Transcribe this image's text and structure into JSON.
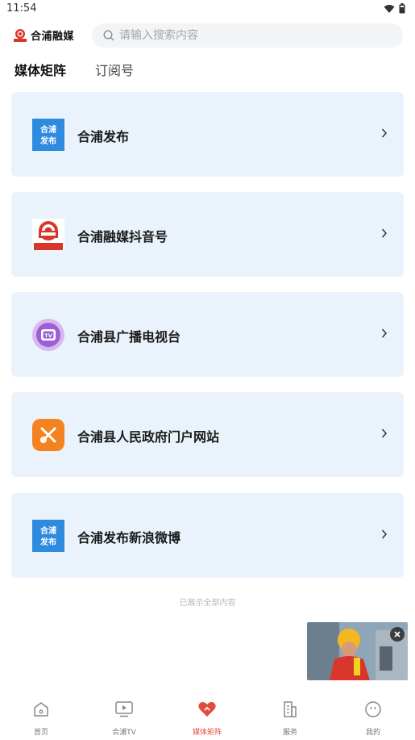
{
  "status_bar": {
    "time": "11:54"
  },
  "header": {
    "logo_text": "合浦融媒",
    "search_placeholder": "请输入搜索内容"
  },
  "tabs": [
    {
      "label": "媒体矩阵",
      "active": true
    },
    {
      "label": "订阅号",
      "active": false
    }
  ],
  "cards": [
    {
      "title": "合浦发布",
      "icon": "hepu-fabu-logo"
    },
    {
      "title": "合浦融媒抖音号",
      "icon": "hepu-rongmei-logo"
    },
    {
      "title": "合浦县广播电视台",
      "icon": "tv-icon"
    },
    {
      "title": "合浦县人民政府门户网站",
      "icon": "government-portal-icon"
    },
    {
      "title": "合浦发布新浪微博",
      "icon": "hepu-fabu-logo"
    }
  ],
  "hepu_logo_text": "合浦\n发布",
  "footer_note": "已展示全部内容",
  "bottom_nav": [
    {
      "label": "首页",
      "icon": "home-icon",
      "active": false
    },
    {
      "label": "合浦TV",
      "icon": "tv-play-icon",
      "active": false
    },
    {
      "label": "媒体矩阵",
      "icon": "heart-icon",
      "active": true
    },
    {
      "label": "服务",
      "icon": "building-icon",
      "active": false
    },
    {
      "label": "我的",
      "icon": "smile-icon",
      "active": false
    }
  ],
  "colors": {
    "card_bg": "#eaf3fb",
    "accent_red": "#e24c3d",
    "brand_blue": "#2f8be0"
  }
}
